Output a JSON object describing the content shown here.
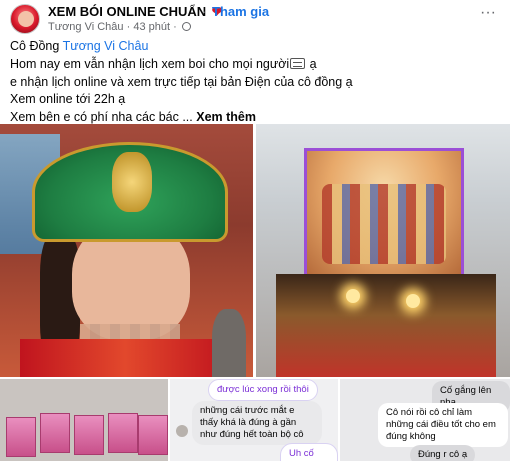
{
  "header": {
    "group_name": "XEM BÓI ONLINE CHUẨN",
    "heart": "❤",
    "separator": "·",
    "join_label": "Tham gia",
    "author": "Tương Vi Châu",
    "time": "43 phút",
    "more": "···"
  },
  "post": {
    "line1_prefix": "Cô Đồng ",
    "line1_mention": "Tương Vi Châu",
    "line2_a": "Hom nay em vẫn nhận lịch xem boi cho mọi người",
    "line2_b": " ạ",
    "line3": "e nhận lịch online và xem trực tiếp tại bản Điện của cô đồng ạ",
    "line4": "Xem online tới 22h ạ",
    "line5": "Xem bên e có phí nha các bác ... ",
    "see_more": "Xem thêm"
  },
  "chat_middle": {
    "msg1": "được lúc xong rồi thôi",
    "msg2": "những cái trước mắt e thấy khá là đúng à gần như đúng hết toàn bộ cô",
    "msg3": "Uh cố lên e"
  },
  "chat_right": {
    "msg1": "Cố gắng lên nha",
    "msg2": "Cô nói rồi cô chỉ làm những cái điều tốt cho em đúng không",
    "msg3": "Đúng r cô ạ"
  },
  "colors": {
    "link": "#1b74e4",
    "heart": "#d8182a",
    "chat_accent": "#7b2fd6"
  }
}
